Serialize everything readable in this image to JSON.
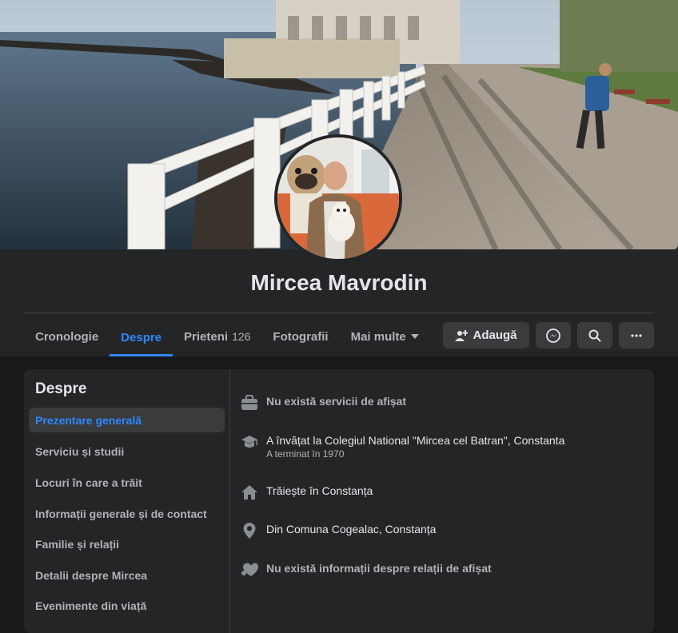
{
  "profile": {
    "name": "Mircea Mavrodin"
  },
  "tabs": [
    {
      "label": "Cronologie"
    },
    {
      "label": "Despre"
    },
    {
      "label": "Prieteni",
      "count": "126"
    },
    {
      "label": "Fotografii"
    },
    {
      "label": "Mai multe"
    }
  ],
  "actions": {
    "add_label": "Adaugă",
    "add_icon": "add-friend-icon",
    "messenger_icon": "messenger-icon",
    "search_icon": "search-icon",
    "more_icon": "more-icon"
  },
  "about": {
    "title": "Despre",
    "menu": [
      "Prezentare generală",
      "Serviciu și studii",
      "Locuri în care a trăit",
      "Informații generale și de contact",
      "Familie și relații",
      "Detalii despre Mircea",
      "Evenimente din viață"
    ],
    "items": [
      {
        "icon": "briefcase-icon",
        "text": "Nu există servicii de afișat",
        "muted": true
      },
      {
        "icon": "graduation-cap-icon",
        "text": "A învățat la Colegiul National \"Mircea cel Batran\", Constanta",
        "sub": "A terminat în 1970"
      },
      {
        "icon": "home-icon",
        "text": "Trăiește în Constanța"
      },
      {
        "icon": "location-pin-icon",
        "text": "Din Comuna Cogealac, Constanța"
      },
      {
        "icon": "heart-icon",
        "text": "Nu există informații despre relații de afișat",
        "muted": true
      }
    ]
  },
  "colors": {
    "accent": "#2d88ff",
    "background": "#18191a",
    "surface": "#242526",
    "button": "#3a3b3c"
  }
}
